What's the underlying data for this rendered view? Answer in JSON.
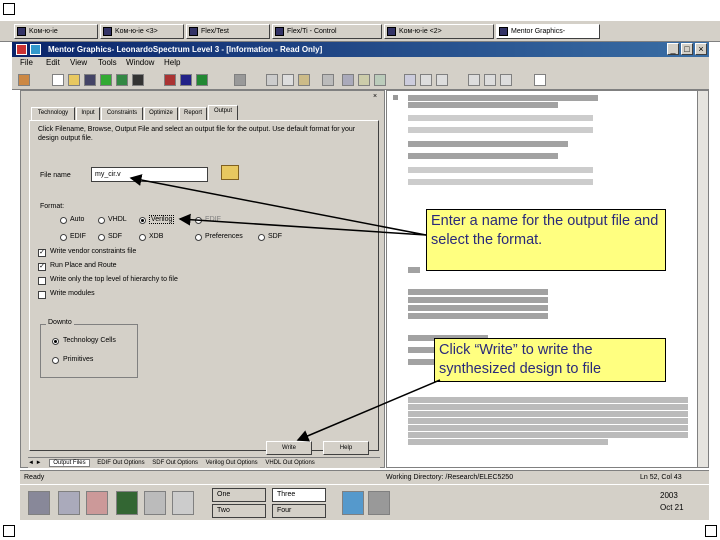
{
  "taskbar_tabs": [
    {
      "label": "Koм-ю-ie",
      "active": false
    },
    {
      "label": "Koм-ю-ie <3>",
      "active": false
    },
    {
      "label": "Flex/Test",
      "active": false
    },
    {
      "label": "Flex/Ti - Control",
      "active": false
    },
    {
      "label": "Koм-ю-ie <2>",
      "active": false
    },
    {
      "label": "Mentor Graphics-",
      "active": true
    }
  ],
  "window": {
    "title": "Mentor Graphics- LeonardoSpectrum Level 3 - [Information - Read Only]",
    "controls": [
      "_",
      "□",
      "×"
    ]
  },
  "menu": [
    "File",
    "Edit",
    "View",
    "Tools",
    "Window",
    "Help"
  ],
  "left_panel": {
    "tabs": [
      "Technology",
      "Input",
      "Constraints",
      "Optimize",
      "Report",
      "Output"
    ],
    "selected_tab": "Output",
    "instruction": "Click Filename, Browse, Output File and select an output file for the output. Use default format for your design output file.",
    "filename_label": "File name",
    "filename_value": "my_cir.v",
    "format_label": "Format:",
    "formats_row1": [
      "Auto",
      "VHDL",
      "Verilog",
      "EDIF"
    ],
    "formats_row2": [
      "EDIF",
      "SDF",
      "XDB",
      "Preferences",
      "SDF"
    ],
    "checkboxes": [
      {
        "label": "Write vendor constraints file",
        "checked": true
      },
      {
        "label": "Run Place and Route",
        "checked": true
      },
      {
        "label": "Write only the top level of hierarchy to file",
        "checked": false
      },
      {
        "label": "Write modules",
        "checked": false
      }
    ],
    "downto_label": "Downto",
    "downto_options": [
      {
        "label": "Technology Cells",
        "selected": true
      },
      {
        "label": "Primitives",
        "selected": false
      }
    ],
    "write_button": "Write",
    "help_button": "Help",
    "bottom_tabs": [
      "Output Files",
      "EDIF Out Options",
      "SDF Out Options",
      "Verilog Out Options",
      "VHDL Out Options"
    ]
  },
  "callouts": {
    "output_name": "Enter a name for the output file and select the format.",
    "write": "Click “Write” to write the synthesized design to file"
  },
  "statusbar": {
    "left": "Ready",
    "middle": "Working Directory: /Research/ELEC5250",
    "right": "Ln 52, Col 43"
  },
  "taskbar": {
    "pagers": [
      "One",
      "Three",
      "Two",
      "Four"
    ],
    "clock_top": "2003",
    "clock_bottom": "Oct 21"
  }
}
